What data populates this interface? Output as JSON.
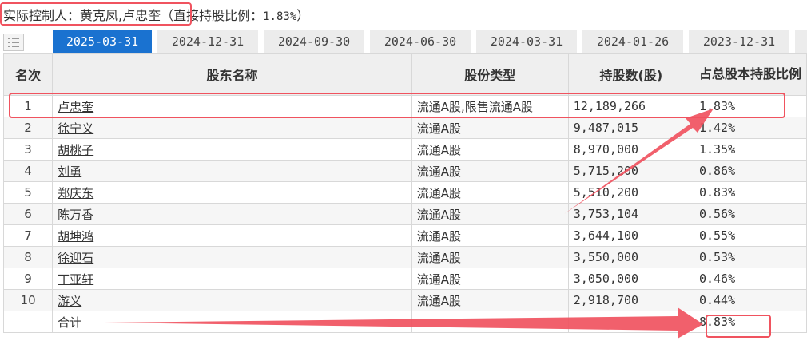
{
  "controller": {
    "label": "实际控制人：黄克凤,卢忠奎",
    "direct_text": "（直接持股比例：",
    "direct_pct": "1.83%",
    "close_paren": "）"
  },
  "tabs": [
    {
      "label": "2025-03-31",
      "active": true
    },
    {
      "label": "2024-12-31",
      "active": false
    },
    {
      "label": "2024-09-30",
      "active": false
    },
    {
      "label": "2024-06-30",
      "active": false
    },
    {
      "label": "2024-03-31",
      "active": false
    },
    {
      "label": "2024-01-26",
      "active": false
    },
    {
      "label": "2023-12-31",
      "active": false
    }
  ],
  "table": {
    "headers": {
      "rank": "名次",
      "name": "股东名称",
      "type": "股份类型",
      "shares": "持股数(股)",
      "pct": "占总股本持股比例"
    },
    "rows": [
      {
        "rank": "1",
        "name": "卢忠奎",
        "type": "流通A股,限售流通A股",
        "shares": "12,189,266",
        "pct": "1.83%"
      },
      {
        "rank": "2",
        "name": "徐宁义",
        "type": "流通A股",
        "shares": "9,487,015",
        "pct": "1.42%"
      },
      {
        "rank": "3",
        "name": "胡桃子",
        "type": "流通A股",
        "shares": "8,970,000",
        "pct": "1.35%"
      },
      {
        "rank": "4",
        "name": "刘勇",
        "type": "流通A股",
        "shares": "5,715,200",
        "pct": "0.86%"
      },
      {
        "rank": "5",
        "name": "郑庆东",
        "type": "流通A股",
        "shares": "5,510,200",
        "pct": "0.83%"
      },
      {
        "rank": "6",
        "name": "陈万香",
        "type": "流通A股",
        "shares": "3,753,104",
        "pct": "0.56%"
      },
      {
        "rank": "7",
        "name": "胡坤鸿",
        "type": "流通A股",
        "shares": "3,644,100",
        "pct": "0.55%"
      },
      {
        "rank": "8",
        "name": "徐迎石",
        "type": "流通A股",
        "shares": "3,550,000",
        "pct": "0.53%"
      },
      {
        "rank": "9",
        "name": "丁亚轩",
        "type": "流通A股",
        "shares": "3,050,000",
        "pct": "0.46%"
      },
      {
        "rank": "10",
        "name": "游义",
        "type": "流通A股",
        "shares": "2,918,700",
        "pct": "0.44%"
      }
    ],
    "total": {
      "label": "合计",
      "pct": "8.83%"
    }
  },
  "colors": {
    "annotation_red": "#f0535f",
    "tab_active": "#1a72d0",
    "tab_inactive": "#ececec",
    "header_bg": "#efefef"
  },
  "icons": {
    "list_button": "list-icon"
  }
}
